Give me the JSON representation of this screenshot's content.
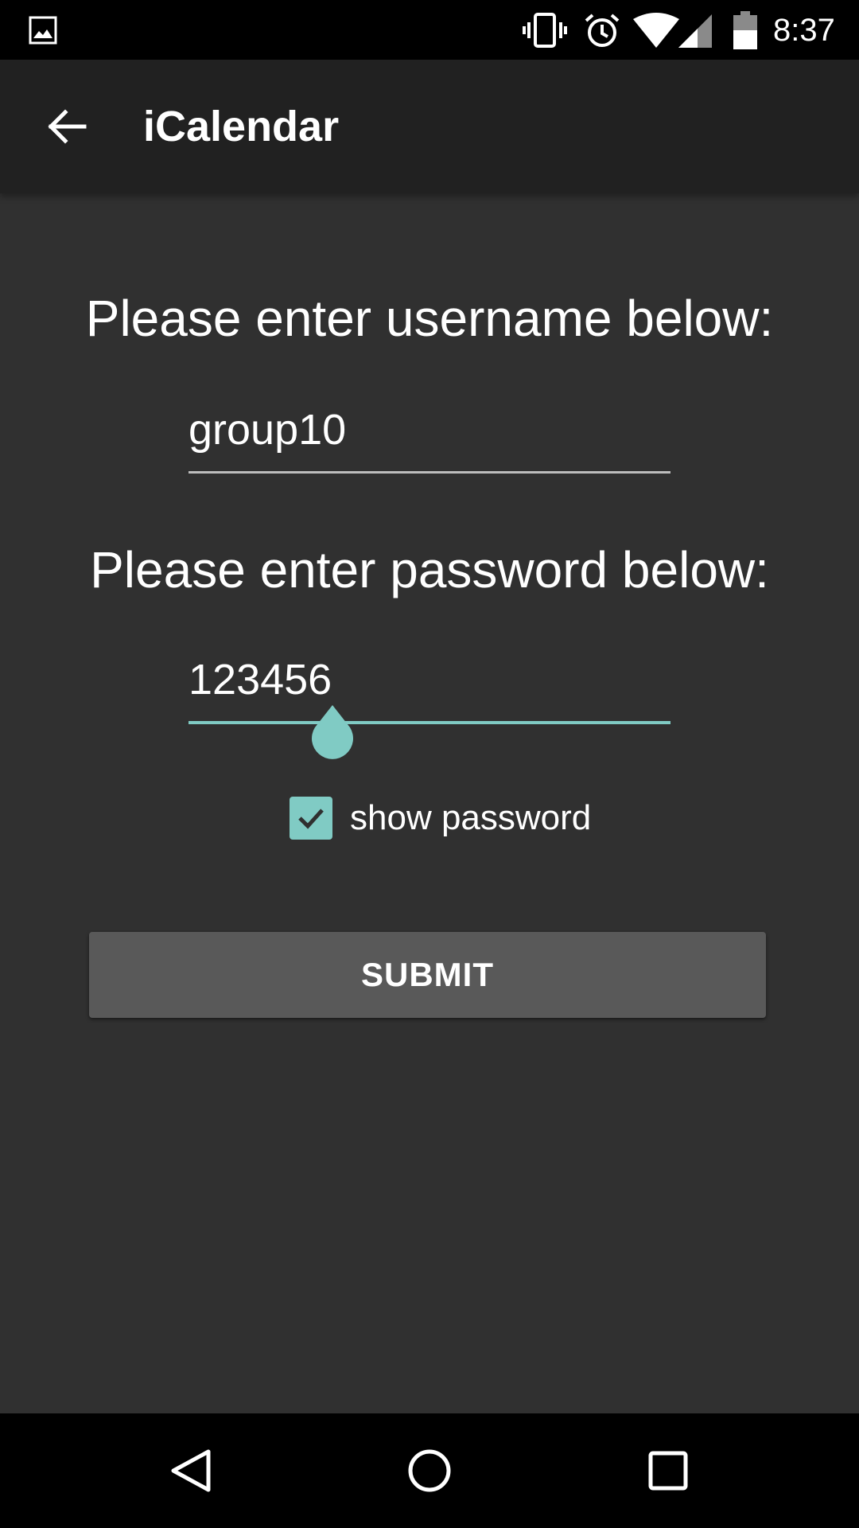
{
  "status_bar": {
    "time": "8:37",
    "icons": [
      "gallery-icon",
      "vibrate-icon",
      "alarm-icon",
      "wifi-icon",
      "signal-icon",
      "battery-icon"
    ]
  },
  "app_bar": {
    "title": "iCalendar",
    "back_icon": "arrow-back-icon"
  },
  "form": {
    "username_label": "Please enter username below:",
    "username_value": "group10",
    "password_label": "Please enter password below:",
    "password_value": "123456",
    "show_password_label": "show password",
    "show_password_checked": true,
    "submit_label": "SUBMIT"
  },
  "colors": {
    "accent": "#80cbc4",
    "background": "#303030",
    "app_bar": "#212121",
    "button": "#595959"
  },
  "nav_bar": {
    "icons": [
      "back-triangle-icon",
      "home-circle-icon",
      "recents-square-icon"
    ]
  }
}
